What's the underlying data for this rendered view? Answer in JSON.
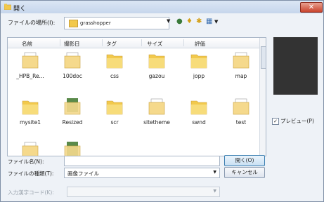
{
  "window": {
    "title": "開く"
  },
  "lookin": {
    "label": "ファイルの場所(I):",
    "value": "grasshopper"
  },
  "columns": [
    "名前",
    "撮影日",
    "タグ",
    "サイズ",
    "評価"
  ],
  "items": [
    {
      "label": "_HPB_Re...",
      "kind": "folder-doc"
    },
    {
      "label": "100doc",
      "kind": "folder-doc"
    },
    {
      "label": "css",
      "kind": "folder"
    },
    {
      "label": "gazou",
      "kind": "folder"
    },
    {
      "label": "jopp",
      "kind": "folder"
    },
    {
      "label": "map",
      "kind": "folder-doc"
    },
    {
      "label": "mysite1",
      "kind": "folder"
    },
    {
      "label": "Resized",
      "kind": "folder-image"
    },
    {
      "label": "scr",
      "kind": "folder"
    },
    {
      "label": "sitetheme",
      "kind": "folder-doc"
    },
    {
      "label": "swnd",
      "kind": "folder"
    },
    {
      "label": "test",
      "kind": "folder-doc"
    },
    {
      "label": "",
      "kind": "folder-doc"
    },
    {
      "label": "",
      "kind": "folder-image"
    }
  ],
  "preview": {
    "label": "プレビュー(P)",
    "checked": true
  },
  "filename": {
    "label": "ファイル名(N):",
    "value": ""
  },
  "filetype": {
    "label": "ファイルの種類(T):",
    "value": "画像ファイル"
  },
  "encoding": {
    "label": "入力漢字コード(K):",
    "value": ""
  },
  "buttons": {
    "open": "開く(O)",
    "cancel": "キャンセル"
  },
  "icons": {
    "close": "close-icon",
    "back": "back-icon",
    "up": "up-folder-icon",
    "newfolder": "new-folder-icon",
    "views": "views-icon"
  }
}
